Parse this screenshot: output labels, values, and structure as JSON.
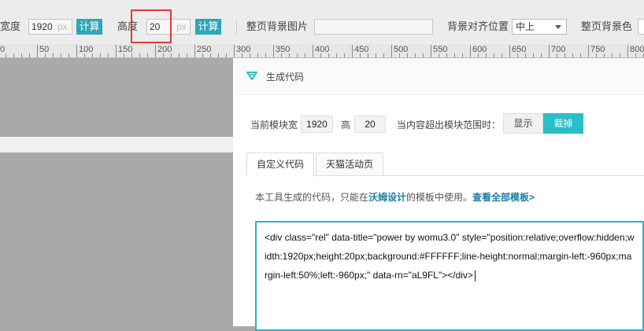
{
  "toolbar": {
    "width_label": "宽度",
    "width_value": "1920",
    "width_unit": "px",
    "width_calc": "计算",
    "height_label": "高度",
    "height_value": "20",
    "height_unit": "px",
    "height_calc": "计算",
    "bg_image_label": "整页背景图片",
    "bg_image_value": "",
    "align_label": "背景对齐位置",
    "align_value": "中上",
    "bg_color_label": "整页背景色"
  },
  "ruler": {
    "labels": [
      "0",
      "50",
      "100",
      "150",
      "200",
      "250",
      "300",
      "350",
      "400",
      "450",
      "500",
      "550",
      "600",
      "650",
      "700",
      "750",
      "800"
    ]
  },
  "dialog": {
    "title": "生成代码",
    "current_width_label": "当前模块宽",
    "current_width": "1920",
    "height_label": "高",
    "current_height": "20",
    "overflow_label": "当内容超出模块范围时：",
    "show_label": "显示",
    "clip_label": "裁掉",
    "tabs": [
      "自定义代码",
      "天猫活动页"
    ],
    "notice_prefix": "本工具生成的代码，只能在",
    "notice_brand": "沃姆设计",
    "notice_middle": "的模板中使用。",
    "notice_link": "查看全部模板>",
    "code": "<div class=\"rel\" data-title=\"power by womu3.0\" style=\"position:relative;overflow:hidden;width:1920px;height:20px;background:#FFFFFF;line-height:normal;margin-left:-960px;margin-left:50%;left:-960px;\" data-rn=\"aL9FL\"></div>"
  },
  "colors": {
    "accent": "#2aa7b8",
    "active_segment": "#2bbdc8",
    "highlight_box": "#e53935",
    "link": "#1d7ea3"
  }
}
